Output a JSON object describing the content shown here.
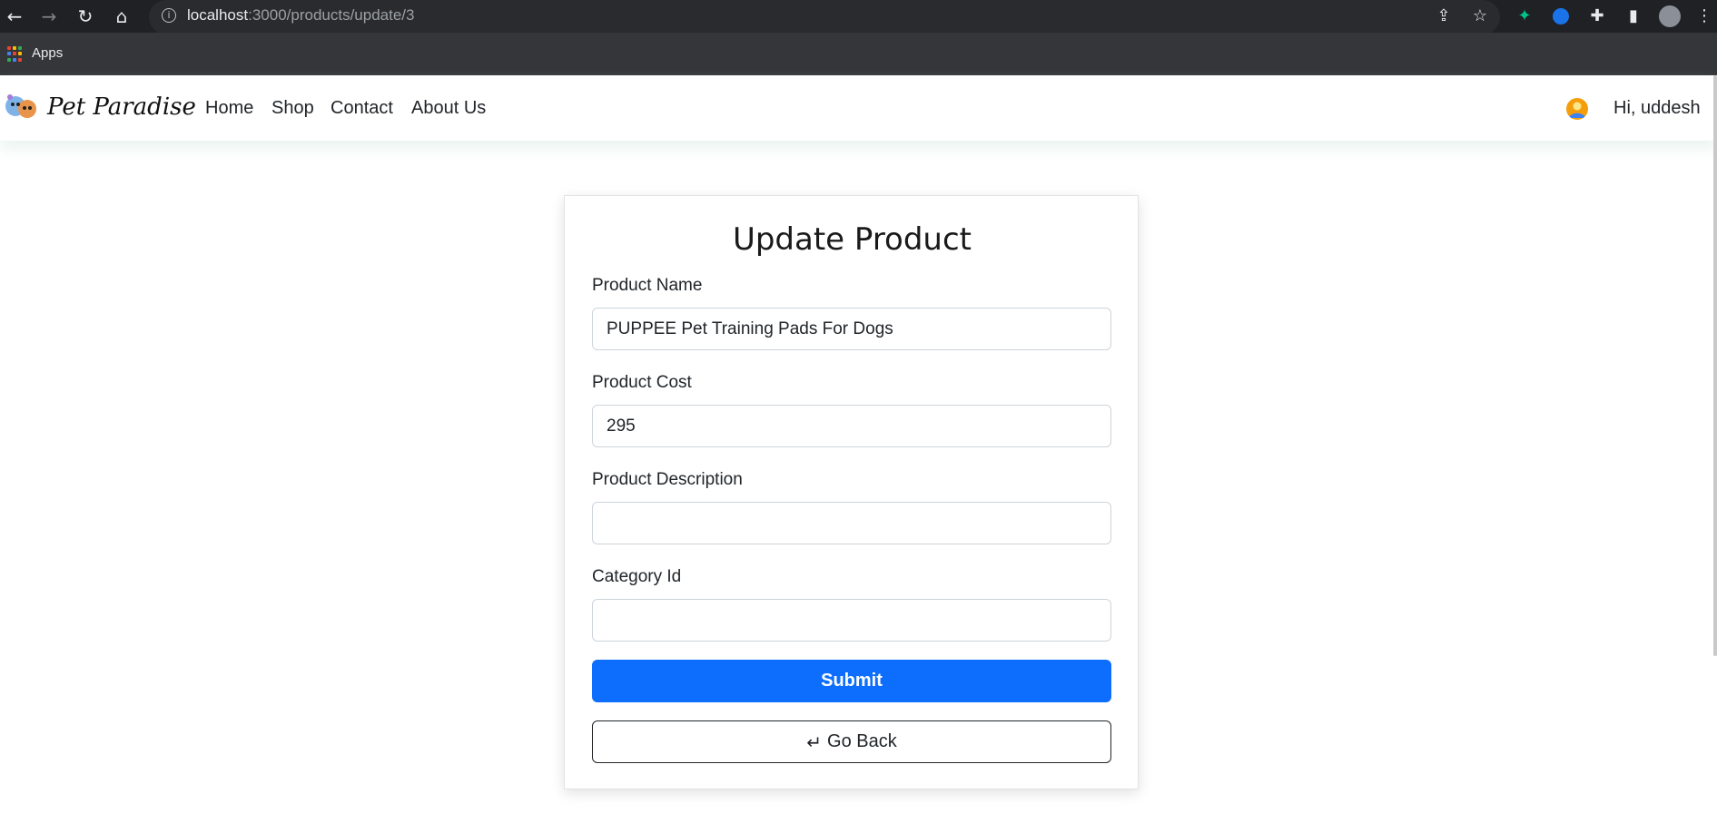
{
  "browser": {
    "url_host": "localhost",
    "url_path": ":3000/products/update/3",
    "bookmarks": {
      "apps_label": "Apps"
    }
  },
  "navbar": {
    "brand": "Pet Paradise",
    "links": [
      "Home",
      "Shop",
      "Contact",
      "About Us"
    ],
    "user_greeting": "Hi, uddesh"
  },
  "form": {
    "title": "Update Product",
    "fields": [
      {
        "label": "Product Name",
        "value": "PUPPEE Pet Training Pads For Dogs"
      },
      {
        "label": "Product Cost",
        "value": "295"
      },
      {
        "label": "Product Description",
        "value": ""
      },
      {
        "label": "Category Id",
        "value": ""
      }
    ],
    "submit_label": "Submit",
    "back_label": "Go Back"
  },
  "colors": {
    "primary": "#0d6efd",
    "chrome_dark": "#202124",
    "bookmark_bar": "#35363a"
  },
  "icons": {
    "back": "arrow-return-left-icon",
    "avatar": "user-avatar-icon"
  }
}
